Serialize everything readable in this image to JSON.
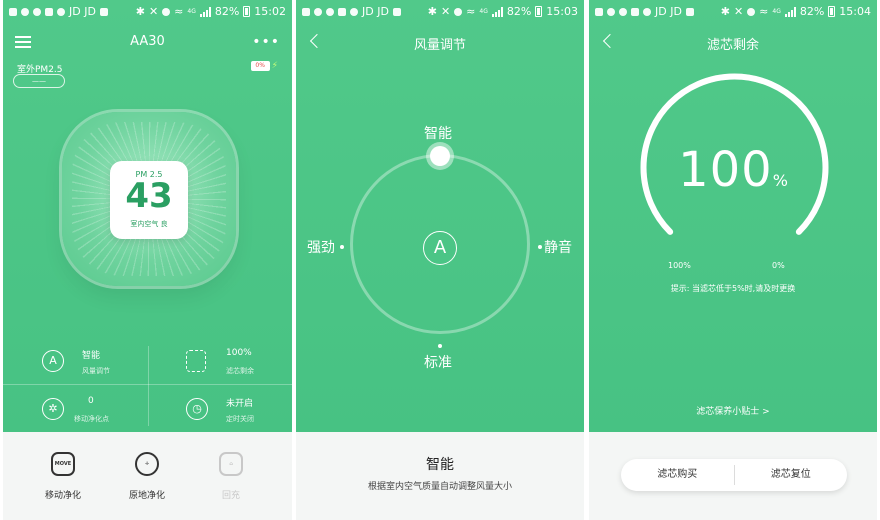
{
  "screens": [
    {
      "status": {
        "carrier": "JD JD",
        "battery": "82%",
        "time": "15:02",
        "network": "4G"
      },
      "header": {
        "title": "AA30"
      },
      "outdoor": {
        "label": "室外PM2.5",
        "value": "——"
      },
      "device_battery": "0%",
      "pm": {
        "label": "PM 2.5",
        "value": "43",
        "quality": "室内空气 良"
      },
      "info": [
        {
          "icon": "A",
          "value": "智能",
          "sub": "风量调节"
        },
        {
          "icon": "filter-icon",
          "value": "100%",
          "sub": "滤芯剩余"
        },
        {
          "icon": "pin-icon",
          "value": "0",
          "sub": "移动净化点"
        },
        {
          "icon": "timer-icon",
          "value": "未开启",
          "sub": "定时关闭"
        }
      ],
      "bottom": [
        {
          "icon": "MOVE",
          "label": "移动净化"
        },
        {
          "icon": "target-icon",
          "label": "原地净化"
        },
        {
          "icon": "home-icon",
          "label": "回充"
        }
      ]
    },
    {
      "status": {
        "carrier": "JD JD",
        "battery": "82%",
        "time": "15:03",
        "network": "4G"
      },
      "header": {
        "title": "风量调节"
      },
      "modes": {
        "top": "智能",
        "left": "强劲",
        "right": "静音",
        "bottom": "标准",
        "center": "A"
      },
      "desc": {
        "title": "智能",
        "text": "根据室内空气质量自动调整风量大小"
      }
    },
    {
      "status": {
        "carrier": "JD JD",
        "battery": "82%",
        "time": "15:04",
        "network": "4G"
      },
      "header": {
        "title": "滤芯剩余"
      },
      "gauge": {
        "value": "100",
        "unit": "%",
        "fraction": 1.0,
        "min_label": "100%",
        "max_label": "0%"
      },
      "tip": "提示:  当滤芯低于5%时,请及时更换",
      "tips_link": "滤芯保养小贴士 >",
      "buttons": {
        "buy": "滤芯购买",
        "reset": "滤芯复位"
      }
    }
  ]
}
